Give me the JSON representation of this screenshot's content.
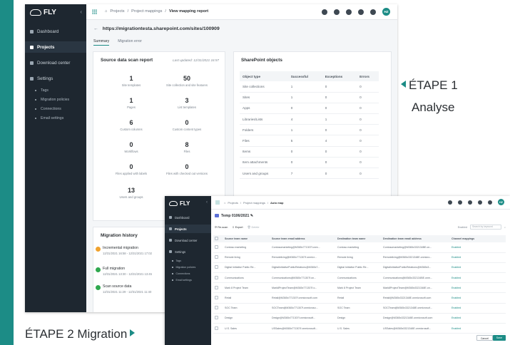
{
  "labels": {
    "etape1": "ÉTAPE 1",
    "analyse": "Analyse",
    "etape2": "ÉTAPE 2 Migration"
  },
  "app": {
    "name": "FLY",
    "user_initials": "HZ"
  },
  "sidebar": {
    "items": [
      {
        "label": "Dashboard",
        "icon": "gauge-icon"
      },
      {
        "label": "Projects",
        "icon": "layers-icon"
      },
      {
        "label": "Download center",
        "icon": "download-icon"
      },
      {
        "label": "Settings",
        "icon": "gear-icon"
      }
    ],
    "sub_items": [
      "Tags",
      "Migration policies",
      "Connections",
      "Email settings"
    ]
  },
  "window1": {
    "breadcrumbs": [
      "Projects",
      "Project mappings",
      "View mapping report"
    ],
    "url": "https://migrationtesta.sharepoint.com/sites/100909",
    "tabs": [
      "Summary",
      "Migration error"
    ],
    "scan": {
      "title": "Source data scan report",
      "updated": "Last updated: 12/31/2021 16:57",
      "stats": [
        {
          "value": "1",
          "label": "Site templates"
        },
        {
          "value": "50",
          "label": "Site collection and site features"
        },
        {
          "value": "1",
          "label": "Pages"
        },
        {
          "value": "3",
          "label": "List templates"
        },
        {
          "value": "6",
          "label": "Custom columns"
        },
        {
          "value": "0",
          "label": "Custom content types"
        },
        {
          "value": "0",
          "label": "Workflows"
        },
        {
          "value": "8",
          "label": "Files"
        },
        {
          "value": "0",
          "label": "Files applied with labels"
        },
        {
          "value": "0",
          "label": "Files with checked out versions"
        },
        {
          "value": "13",
          "label": "Users and groups"
        }
      ]
    },
    "sharepoint": {
      "title": "SharePoint objects",
      "headers": [
        "Object type",
        "Successful",
        "Exceptions",
        "Errors"
      ],
      "rows": [
        [
          "Site collections",
          "1",
          "0",
          "0"
        ],
        [
          "Sites",
          "1",
          "0",
          "0"
        ],
        [
          "Apps",
          "0",
          "0",
          "0"
        ],
        [
          "Libraries/Lists",
          "4",
          "1",
          "0"
        ],
        [
          "Folders",
          "1",
          "0",
          "0"
        ],
        [
          "Files",
          "5",
          "4",
          "0"
        ],
        [
          "Items",
          "0",
          "0",
          "0"
        ],
        [
          "Item attachments",
          "0",
          "0",
          "0"
        ],
        [
          "Users and groups",
          "7",
          "0",
          "0"
        ]
      ]
    },
    "history": {
      "title": "Migration history",
      "entries": [
        {
          "name": "Incremental migration",
          "date": "12/31/2021 16:58 - 12/31/2021 17:02",
          "status": "warning"
        },
        {
          "name": "Full migration",
          "date": "12/31/2021 13:30 - 12/31/2021 13:45",
          "status": "success"
        },
        {
          "name": "Scan source data",
          "date": "12/31/2021 11:29 - 12/31/2021 11:40",
          "status": "success"
        }
      ]
    }
  },
  "window2": {
    "breadcrumbs": [
      "Projects",
      "Project mappings",
      "Auto map"
    ],
    "project": "Temp 0106/2021",
    "toolbar": [
      "Re-scan",
      "Export",
      "Delete"
    ],
    "filter_label": "Enabled",
    "search_placeholder": "Search by keyword",
    "headers": [
      "",
      "Source team name",
      "Source team email address",
      "Destination team name",
      "Destination team email address",
      "Channel mappings"
    ],
    "rows": [
      [
        "Contoso marketing",
        "Contosomarketing@M365x771307f.onm...",
        "Contoso marketing",
        "Contosomarketing@M365x332134BE.on...",
        "Enabled"
      ],
      [
        "Remote living",
        "Remoteliving@M365x771307f.onmicr...",
        "Remote living",
        "Remoteliving@M365x3321348E.onmicro...",
        "Enabled"
      ],
      [
        "Digital Initiative Public Re...",
        "DigitalInitiativePublicRelations@M365x7...",
        "Digital Initiative Public Re...",
        "DigitalInitiativePublicRelations@M365x3...",
        "Enabled"
      ],
      [
        "Communications",
        "Communications@M365x771307f.on...",
        "Communications",
        "Communications@M365x332134BE.onm...",
        "Enabled"
      ],
      [
        "Mark 8 Project Team",
        "Mark8ProjectTeam@M365x771307f.o...",
        "Mark 8 Project Team",
        "Mark8ProjectTeam@M365x3321348E.on...",
        "Enabled"
      ],
      [
        "Retail",
        "Retail@M365x771307f.onmicrosoft.com",
        "Retail",
        "Retail@M365x3321348E.onmicrosoft.com",
        "Enabled"
      ],
      [
        "SOC Team",
        "SOCTeam@M365x771307f.onmicroso...",
        "SOC Team",
        "SOCTeam@M365x3321348E.onmicrosof...",
        "Enabled"
      ],
      [
        "Design",
        "Design@M365x771307f.onmicrosoft...",
        "Design",
        "Design@M365x3321348E.onmicrosoft.com",
        "Enabled"
      ],
      [
        "U.S. Sales",
        "USSales@M365x771307f.onmicrosoft...",
        "U.S. Sales",
        "USSales@M365x3321348E.onmicrosoft...",
        "Enabled"
      ]
    ],
    "buttons": {
      "cancel": "Cancel",
      "save": "Save"
    }
  }
}
